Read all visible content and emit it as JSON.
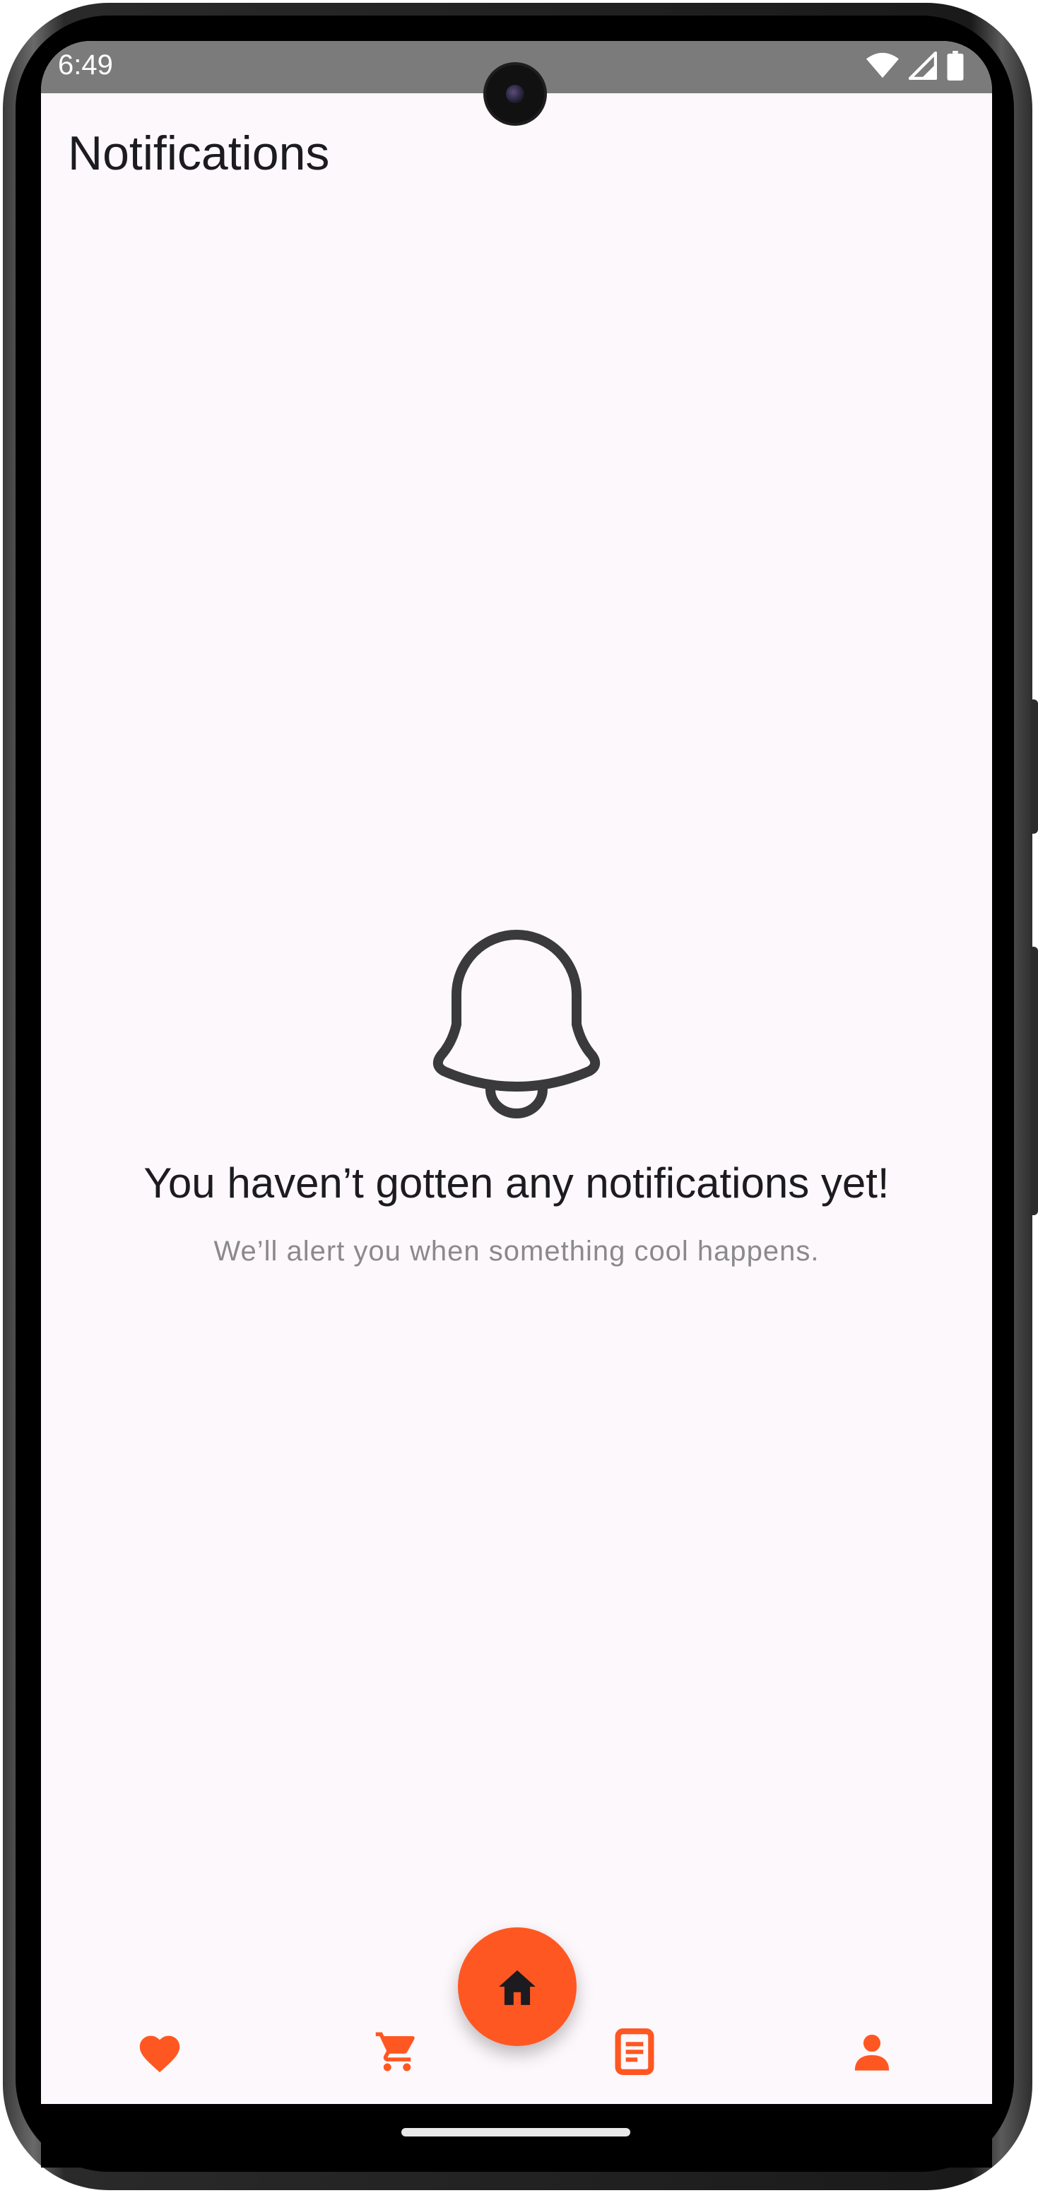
{
  "status_bar": {
    "time": "6:49",
    "icons": [
      "wifi-icon",
      "signal-icon",
      "battery-icon"
    ]
  },
  "header": {
    "title": "Notifications"
  },
  "empty_state": {
    "icon": "bell-icon",
    "heading": "You haven’t gotten any notifications yet!",
    "subtext": "We’ll alert you when something cool happens."
  },
  "bottom_nav": {
    "items": [
      {
        "icon": "heart-icon",
        "name": "favorites"
      },
      {
        "icon": "cart-icon",
        "name": "cart"
      },
      {
        "icon": "home-icon",
        "name": "home",
        "selected": true
      },
      {
        "icon": "document-icon",
        "name": "orders"
      },
      {
        "icon": "person-icon",
        "name": "profile"
      }
    ]
  },
  "colors": {
    "accent": "#ff5722",
    "background": "#fdf8fc",
    "status_bar": "#7b7b7b",
    "text_primary": "#1c1b1f",
    "text_secondary": "#8a8a8a"
  }
}
